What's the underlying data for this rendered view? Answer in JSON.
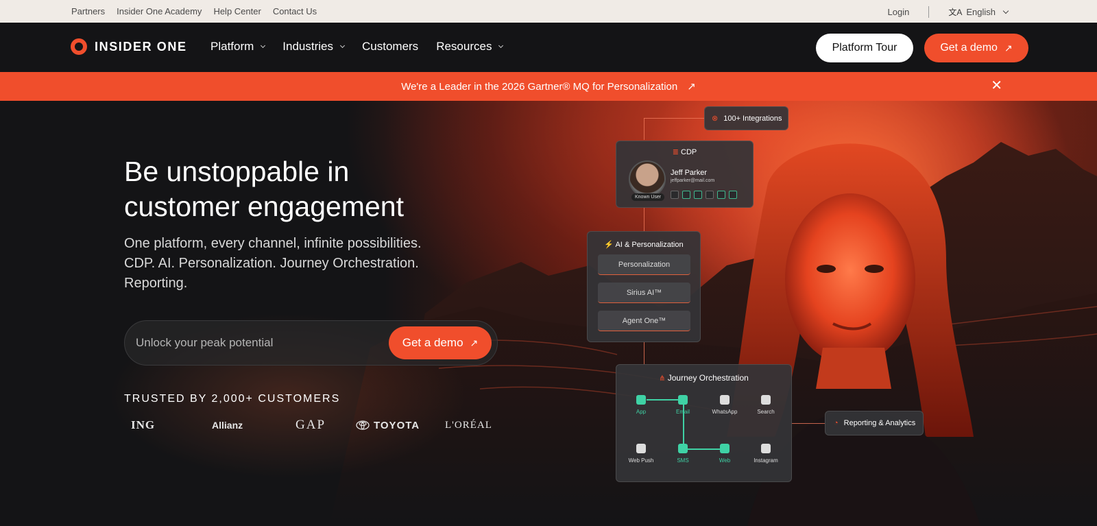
{
  "utility_bar": {
    "links": [
      "Partners",
      "Insider One Academy",
      "Help Center",
      "Contact Us"
    ],
    "login": "Login",
    "language": "English",
    "language_icon": "translate-icon"
  },
  "nav": {
    "brand": "INSIDER ONE",
    "items": [
      {
        "label": "Platform",
        "has_dropdown": true
      },
      {
        "label": "Industries",
        "has_dropdown": true
      },
      {
        "label": "Customers",
        "has_dropdown": false
      },
      {
        "label": "Resources",
        "has_dropdown": true
      }
    ],
    "tour_button": "Platform Tour",
    "demo_button": "Get a demo"
  },
  "announcement": {
    "text": "We're a Leader in the 2026 Gartner® MQ for Personalization",
    "arrow": "↗",
    "close": "✕"
  },
  "hero": {
    "title_line1": "Be unstoppable in",
    "title_line2": "customer engagement",
    "subtitle_line1": "One platform, every channel, infinite possibilities.",
    "subtitle_line2": "CDP. AI. Personalization. Journey Orchestration.",
    "subtitle_line3": "Reporting.",
    "input_placeholder": "Unlock your peak potential",
    "cta_button": "Get a demo",
    "trusted_label": "TRUSTED BY 2,000+ CUSTOMERS",
    "customer_logos": [
      "ING",
      "Allianz",
      "GAP",
      "TOYOTA",
      "L'ORÉAL"
    ]
  },
  "diagram": {
    "integrations": "100+ Integrations",
    "cdp": {
      "title": "CDP",
      "name": "Jeff Parker",
      "email": "jeffparker@mail.com",
      "badge": "Known User"
    },
    "ai": {
      "title": "AI & Personalization",
      "items": [
        "Personalization",
        "Sirius AI™",
        "Agent One™"
      ]
    },
    "journey": {
      "title": "Journey Orchestration",
      "nodes": [
        "App",
        "Email",
        "WhatsApp",
        "Search",
        "Web Push",
        "SMS",
        "Web",
        "Instagram"
      ]
    },
    "reporting": "Reporting & Analytics"
  },
  "colors": {
    "accent": "#f04e2c",
    "background": "#141416",
    "utility_bg": "#f0ebe6",
    "journey_active": "#3fd2a5"
  }
}
